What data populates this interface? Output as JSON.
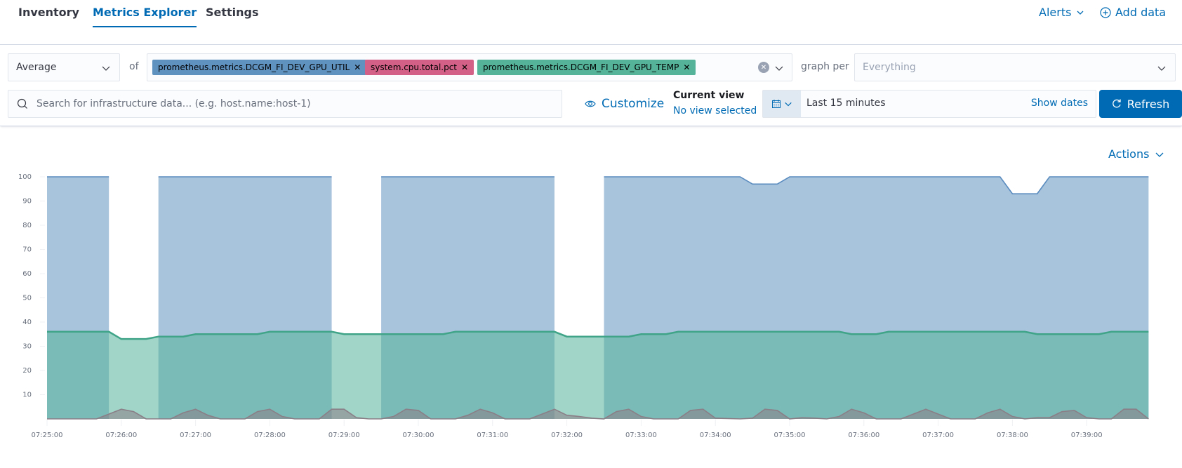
{
  "nav": {
    "tabs": [
      {
        "label": "Inventory",
        "active": false
      },
      {
        "label": "Metrics Explorer",
        "active": true
      },
      {
        "label": "Settings",
        "active": false
      }
    ],
    "alerts_label": "Alerts",
    "add_data_label": "Add data"
  },
  "toolbar": {
    "aggregation": "Average",
    "of_label": "of",
    "metrics": [
      {
        "label": "prometheus.metrics.DCGM_FI_DEV_GPU_UTIL",
        "color": "#6092c0"
      },
      {
        "label": "system.cpu.total.pct",
        "color": "#d36086"
      },
      {
        "label": "prometheus.metrics.DCGM_FI_DEV_GPU_TEMP",
        "color": "#54b399"
      }
    ],
    "graph_per_label": "graph per",
    "graph_per_placeholder": "Everything",
    "search_placeholder": "Search for infrastructure data... (e.g. host.name:host-1)",
    "customize_label": "Customize",
    "current_view_title": "Current view",
    "current_view_value": "No view selected",
    "time_range": "Last 15 minutes",
    "show_dates_label": "Show dates",
    "refresh_label": "Refresh"
  },
  "actions_label": "Actions",
  "chart_data": {
    "type": "area",
    "title": "",
    "xlabel": "",
    "ylabel": "",
    "ylim": [
      0,
      100
    ],
    "yticks": [
      10,
      20,
      30,
      40,
      50,
      60,
      70,
      80,
      90,
      100
    ],
    "x_tick_labels": [
      "07:25:00",
      "07:26:00",
      "07:27:00",
      "07:28:00",
      "07:29:00",
      "07:30:00",
      "07:31:00",
      "07:32:00",
      "07:33:00",
      "07:34:00",
      "07:35:00",
      "07:36:00",
      "07:37:00",
      "07:38:00",
      "07:39:00"
    ],
    "x_unit": "seconds since 07:25:00",
    "x_domain": [
      0,
      890
    ],
    "series": [
      {
        "name": "prometheus.metrics.DCGM_FI_DEV_GPU_UTIL",
        "color": "#6092c0",
        "points": [
          [
            0,
            100
          ],
          [
            50,
            100
          ],
          null,
          [
            90,
            100
          ],
          [
            230,
            100
          ],
          null,
          [
            270,
            100
          ],
          [
            410,
            100
          ],
          null,
          [
            450,
            100
          ],
          [
            560,
            100
          ],
          [
            570,
            97
          ],
          [
            590,
            97
          ],
          [
            600,
            100
          ],
          [
            770,
            100
          ],
          [
            780,
            93
          ],
          [
            800,
            93
          ],
          [
            810,
            100
          ],
          [
            890,
            100
          ]
        ]
      },
      {
        "name": "prometheus.metrics.DCGM_FI_DEV_GPU_TEMP",
        "color": "#54b399",
        "points": [
          [
            0,
            36
          ],
          [
            50,
            36
          ],
          [
            60,
            33
          ],
          [
            80,
            33
          ],
          [
            90,
            34
          ],
          [
            110,
            34
          ],
          [
            120,
            35
          ],
          [
            170,
            35
          ],
          [
            180,
            36
          ],
          [
            230,
            36
          ],
          [
            240,
            35
          ],
          [
            270,
            35
          ],
          [
            320,
            35
          ],
          [
            330,
            36
          ],
          [
            410,
            36
          ],
          [
            420,
            34
          ],
          [
            450,
            34
          ],
          [
            470,
            34
          ],
          [
            480,
            35
          ],
          [
            500,
            35
          ],
          [
            510,
            36
          ],
          [
            640,
            36
          ],
          [
            650,
            35
          ],
          [
            670,
            35
          ],
          [
            680,
            36
          ],
          [
            790,
            36
          ],
          [
            800,
            35
          ],
          [
            850,
            35
          ],
          [
            860,
            36
          ],
          [
            890,
            36
          ]
        ]
      },
      {
        "name": "system.cpu.total.pct",
        "color": "#8a7f87",
        "points": [
          [
            0,
            0
          ],
          [
            40,
            0
          ],
          [
            50,
            2
          ],
          [
            60,
            4
          ],
          [
            70,
            3
          ],
          [
            80,
            0
          ],
          [
            100,
            0
          ],
          [
            110,
            2.5
          ],
          [
            120,
            4
          ],
          [
            130,
            1.5
          ],
          [
            140,
            0
          ],
          [
            160,
            0
          ],
          [
            170,
            3
          ],
          [
            180,
            4
          ],
          [
            190,
            1
          ],
          [
            200,
            0
          ],
          [
            220,
            0
          ],
          [
            230,
            4
          ],
          [
            240,
            4
          ],
          [
            250,
            0.5
          ],
          [
            260,
            0
          ],
          [
            270,
            0
          ],
          [
            280,
            1
          ],
          [
            290,
            4
          ],
          [
            300,
            3.5
          ],
          [
            310,
            0
          ],
          [
            330,
            0
          ],
          [
            340,
            1.5
          ],
          [
            350,
            4
          ],
          [
            360,
            2.5
          ],
          [
            370,
            0
          ],
          [
            390,
            0
          ],
          [
            400,
            2
          ],
          [
            410,
            4
          ],
          [
            420,
            1.5
          ],
          [
            430,
            1
          ],
          [
            440,
            0.3
          ],
          [
            450,
            0
          ],
          [
            460,
            3
          ],
          [
            470,
            4
          ],
          [
            480,
            1
          ],
          [
            490,
            0
          ],
          [
            510,
            0
          ],
          [
            520,
            3.5
          ],
          [
            530,
            4
          ],
          [
            540,
            0.3
          ],
          [
            560,
            0
          ],
          [
            570,
            0.3
          ],
          [
            580,
            4
          ],
          [
            590,
            3.5
          ],
          [
            600,
            0
          ],
          [
            610,
            0.5
          ],
          [
            620,
            0.3
          ],
          [
            630,
            0
          ],
          [
            640,
            1
          ],
          [
            650,
            4
          ],
          [
            660,
            2.5
          ],
          [
            670,
            0
          ],
          [
            690,
            0
          ],
          [
            700,
            2
          ],
          [
            710,
            4
          ],
          [
            720,
            2
          ],
          [
            730,
            0
          ],
          [
            750,
            0
          ],
          [
            760,
            2.5
          ],
          [
            770,
            4
          ],
          [
            780,
            1
          ],
          [
            790,
            0
          ],
          [
            800,
            0.5
          ],
          [
            810,
            0.5
          ],
          [
            820,
            3
          ],
          [
            830,
            3.5
          ],
          [
            840,
            0.5
          ],
          [
            850,
            0
          ],
          [
            860,
            0
          ],
          [
            870,
            4
          ],
          [
            880,
            4
          ],
          [
            890,
            0
          ]
        ]
      }
    ]
  }
}
